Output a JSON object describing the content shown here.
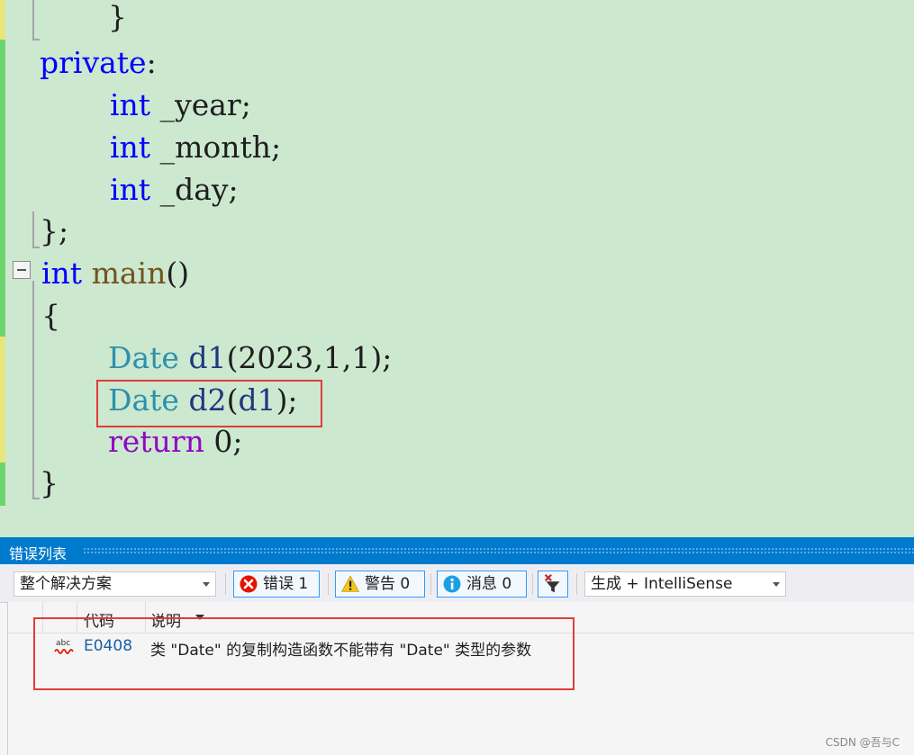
{
  "code_lines": {
    "l1": "}",
    "l2_kw": "private",
    "l2_punct": ":",
    "l3_kw": "int",
    "l3_rest": " _year;",
    "l4_kw": "int",
    "l4_rest": " _month;",
    "l5_kw": "int",
    "l5_rest": " _day;",
    "l6": "};",
    "l7_kw": "int",
    "l7_fn": "main",
    "l7_rest": "()",
    "l8": "{",
    "l9_type": "Date",
    "l9_var": "d1",
    "l9_rest": "(2023,1,1);",
    "l10_type": "Date",
    "l10_var": "d2",
    "l10_open": "(",
    "l10_arg": "d1",
    "l10_close": ");",
    "l11_kw": "return",
    "l11_rest": " 0;",
    "l12": "}"
  },
  "error_list": {
    "title": "错误列表",
    "scope_combo": "整个解决方案",
    "errors_btn": "错误 1",
    "warnings_btn": "警告 0",
    "messages_btn": "消息 0",
    "build_combo": "生成 + IntelliSense",
    "columns": {
      "code": "代码",
      "description": "说明"
    },
    "rows": [
      {
        "icon": "abc-squiggle-icon",
        "code": "E0408",
        "description": "类 \"Date\" 的复制构造函数不能带有 \"Date\" 类型的参数"
      }
    ]
  },
  "watermark": "CSDN @吾与C",
  "colors": {
    "editor_bg": "#cce8cf",
    "keyword": "#0000ff",
    "type": "#2b91af",
    "highlight_box": "#e03c3c",
    "panel_title": "#007acc"
  }
}
